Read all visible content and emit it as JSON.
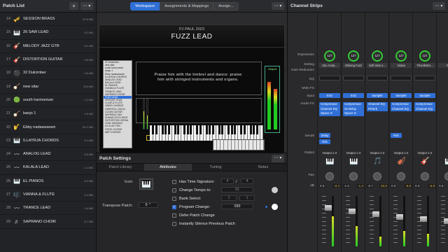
{
  "patch_list": {
    "title": "Patch List",
    "add_label": "+",
    "menu_label": "⋯ ▾",
    "items": [
      {
        "num": "14",
        "name": "SESSION BRASS",
        "size": "20.5 MB",
        "icon": "brass-icon"
      },
      {
        "num": "15",
        "name": "26 SAW LEAD",
        "size": "5.2 MB",
        "icon": "keyboard-icon"
      },
      {
        "num": "16",
        "name": "MELODY JAZZ GTR",
        "size": "8.1 MB",
        "icon": "guitar-icon"
      },
      {
        "num": "17",
        "name": "DISTORTION GUITAR",
        "size": "9.8 MB",
        "icon": "guitar-icon"
      },
      {
        "num": "18",
        "name": "32 Dulcimber",
        "size": "0.6 MB",
        "icon": "mallet-icon"
      },
      {
        "num": "19",
        "name": "new sitar",
        "size": "193 MB",
        "icon": "sitar-icon"
      },
      {
        "num": "20",
        "name": "south harmonium",
        "size": "1.2 MB",
        "icon": "green-circle-icon"
      },
      {
        "num": "21",
        "name": "banjo 1",
        "size": "1.6 MB",
        "icon": "banjo-icon"
      },
      {
        "num": "22",
        "name": "Ebby nadaswaram",
        "size": "63.2 MB",
        "icon": "wind-icon"
      },
      {
        "num": "23",
        "name": "ILLAYRJA CHORDS",
        "size": "9.4 MB",
        "icon": "keyboard-icon"
      },
      {
        "num": "24",
        "name": "ANALOG LEAD",
        "size": "6.8 MB",
        "icon": "waveform-icon"
      },
      {
        "num": "25",
        "name": "KALALA LEAD",
        "size": "1.4 MB",
        "icon": "waveform-icon"
      },
      {
        "num": "26",
        "name": "EL PIANOS",
        "size": "8.5 MB",
        "icon": "keyboard-icon"
      },
      {
        "num": "27",
        "name": "VIANNA & FLUTE",
        "size": "5.4 MB",
        "icon": "flute-icon"
      },
      {
        "num": "28",
        "name": "TRANCE LEAD",
        "size": "1.8 MB",
        "icon": "waveform-icon"
      },
      {
        "num": "29",
        "name": "SAPRANO CHOIR",
        "size": "6.7 MB",
        "icon": "choir-icon"
      }
    ]
  },
  "toolbar": {
    "tabs": [
      {
        "label": "Workspace",
        "active": true
      },
      {
        "label": "Assignments & Mappings",
        "active": false
      },
      {
        "label": "Assign...",
        "active": false
      }
    ],
    "menu_label": "⋯ ▾"
  },
  "workspace": {
    "artist": "PJ PAUL 2023",
    "patch_name": "FUZZ LEAD",
    "verse": "Praise him with the timbrel and dance: praise him with stringed instruments and organs.",
    "output_label": "Output",
    "mini_list": [
      "32 Dulcimber",
      "new sitar",
      "south harmonium",
      "banjo 1",
      "Ebby nadaswaram",
      "ILLAYRJA CHORDS",
      "ANALOG LEAD",
      "KALALA LEAD",
      "EL PIANOS",
      "VIANNA & FLUTE",
      "TRANCE LEAD",
      "SAPRANO CHOIR",
      "FUZZ LEAD",
      "VINTAGE LEAD",
      "CLAIR & FLUTE",
      "VIBRO CHORDS",
      "ORIENTAL VIOLIN",
      "CLEAN GUITAR",
      "SAPRANO SAX",
      "SHANAI EXCLUSIVE",
      "DISTORTION VEENA",
      "LEAD SARANGI",
      "DX ELECTRIC",
      "STEEL GUITAR",
      "ABP CHORDS"
    ],
    "mini_selected_index": 12
  },
  "patch_settings": {
    "title": "Patch Settings",
    "menu_label": "⋯ ▾",
    "tabs": [
      {
        "label": "Patch Library",
        "active": false
      },
      {
        "label": "Attributes",
        "active": true
      },
      {
        "label": "Tuning",
        "active": false
      },
      {
        "label": "Notes",
        "active": false
      }
    ],
    "icon_label": "Icon:",
    "transpose_label": "Transpose Patch:",
    "transpose_value": "0",
    "has_time_sig_label": "Has Time Signature:",
    "time_sig_num": "4",
    "time_sig_den": "4",
    "tempo_label": "Change Tempo to:",
    "tempo_value": "91",
    "bank_label": "Bank Select:",
    "bank_msb": "1",
    "bank_lsb": "1",
    "program_label": "Program Change:",
    "program_value": "030",
    "program_checked": true,
    "defer_label": "Defer Patch Change",
    "silence_label": "Instantly Silence Previous Patch"
  },
  "channel_strips": {
    "title": "Channel Strips",
    "menu_label": "⋯ ▾",
    "row_labels": {
      "expression": "Expression",
      "setting": "Setting",
      "gain_reduction": "Gain Reduction",
      "eq": "EQ",
      "midi_fx": "MIDI FX",
      "input": "Input",
      "audio_fx": "Audio FX",
      "sends": "Sends",
      "output": "Output",
      "pan": "Pan",
      "db": "dB"
    },
    "strips": [
      {
        "expression": "127",
        "setting": "011-Anda...",
        "input": "ES2",
        "fx": [
          "Compressor",
          "Channel EQ",
          "",
          "",
          "",
          "",
          "",
          "",
          "Space D"
        ],
        "sends": [
          "Delay",
          "Rvb"
        ],
        "output": "Output 1-2",
        "icon": "keyboard-icon",
        "val_a": "0.5",
        "val_b": "-0.4",
        "val_b_color": "#e0c040",
        "fader": 0.8,
        "meter": 0.6
      },
      {
        "expression": "127",
        "setting": "Shining Fuzz",
        "input": "ES2",
        "fx": [
          "Compressor",
          "St-Delay",
          "Space D"
        ],
        "sends": [],
        "output": "Output 1-2",
        "icon": "keyboard-icon",
        "val_a": "-1.6",
        "val_b": "-1.4",
        "val_b_color": "#e0c040",
        "fader": 0.72,
        "meter": 0.4
      },
      {
        "expression": "127",
        "setting": "Soft slow s...",
        "input": "Sampler",
        "fx": [
          "Channel EQ",
          "PtVerb"
        ],
        "sends": [],
        "output": "Output 1-2",
        "icon": "note-icon",
        "val_a": "-0.7",
        "val_b": "-10.0",
        "val_b_color": "#e0c040",
        "fader": 0.65,
        "meter": 0.2
      },
      {
        "expression": "127",
        "setting": "Violas",
        "input": "Sampler",
        "fx": [
          "Compressor",
          "Channel EQ"
        ],
        "sends": [
          "Rvb"
        ],
        "output": "Output 1-2",
        "icon": "violin-icon",
        "val_a": "0.0",
        "val_b": "-6.6",
        "val_b_color": "#e0c040",
        "fader": 0.6,
        "meter": 0.3
      },
      {
        "expression": "127",
        "setting": "Thumbstro...",
        "input": "Sampler",
        "fx": [
          "Compressor",
          "Channel EQ"
        ],
        "sends": [],
        "output": "Output 1-2",
        "icon": "guitar-icon",
        "val_a": "0.0",
        "val_b": "-6.8",
        "val_b_color": "#e0c040",
        "fader": 0.55,
        "meter": 0.25
      },
      {
        "expression": "",
        "setting": "Pia",
        "input": "",
        "fx": [],
        "sends": [],
        "output": "",
        "icon": "keyboard-icon",
        "val_a": "0.5",
        "val_b": "",
        "val_b_color": "#e0c040",
        "fader": 0.5,
        "meter": 0.2
      }
    ]
  }
}
